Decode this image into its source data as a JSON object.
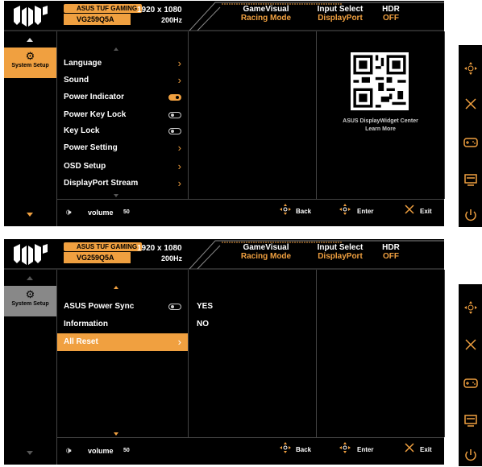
{
  "screens": [
    {
      "header": {
        "badge1": "ASUS TUF GAMING",
        "badge2": "VG259Q5A",
        "resolution": "1920 x 1080",
        "refresh": "200Hz",
        "status": [
          {
            "label": "GameVisual",
            "value": "Racing Mode"
          },
          {
            "label": "Input Select",
            "value": "DisplayPort"
          },
          {
            "label": "HDR",
            "value": "OFF"
          }
        ]
      },
      "sidebar": {
        "tab_label": "System Setup"
      },
      "menu": [
        {
          "label": "Language",
          "kind": "chevron"
        },
        {
          "label": "Sound",
          "kind": "chevron"
        },
        {
          "label": "Power Indicator",
          "kind": "toggle",
          "state": "on"
        },
        {
          "label": "Power Key Lock",
          "kind": "toggle",
          "state": "off"
        },
        {
          "label": "Key Lock",
          "kind": "toggle",
          "state": "off"
        },
        {
          "label": "Power Setting",
          "kind": "chevron"
        },
        {
          "label": "OSD Setup",
          "kind": "chevron"
        },
        {
          "label": "DisplayPort Stream",
          "kind": "chevron"
        }
      ],
      "qr": {
        "line1": "ASUS DisplayWidget Center",
        "line2": "Learn More"
      },
      "footer": {
        "volume_label": "volume",
        "volume_value": "50",
        "back": "Back",
        "enter": "Enter",
        "exit": "Exit"
      }
    },
    {
      "header": {
        "badge1": "ASUS TUF GAMING",
        "badge2": "VG259Q5A",
        "resolution": "1920 x 1080",
        "refresh": "200Hz",
        "status": [
          {
            "label": "GameVisual",
            "value": "Racing Mode"
          },
          {
            "label": "Input Select",
            "value": "DisplayPort"
          },
          {
            "label": "HDR",
            "value": "OFF"
          }
        ]
      },
      "sidebar": {
        "tab_label": "System Setup"
      },
      "menu": [
        {
          "label": "ASUS Power Sync",
          "kind": "toggle",
          "state": "off"
        },
        {
          "label": "Information",
          "kind": "none"
        },
        {
          "label": "All Reset",
          "kind": "chevron",
          "selected": true
        }
      ],
      "options": [
        "YES",
        "NO"
      ],
      "footer": {
        "volume_label": "volume",
        "volume_value": "50",
        "back": "Back",
        "enter": "Enter",
        "exit": "Exit"
      }
    }
  ],
  "side_keys": [
    "joystick-icon",
    "close-icon",
    "gamepad-icon",
    "input-icon",
    "power-icon"
  ],
  "colors": {
    "accent": "#f0a040",
    "background": "#000000"
  }
}
